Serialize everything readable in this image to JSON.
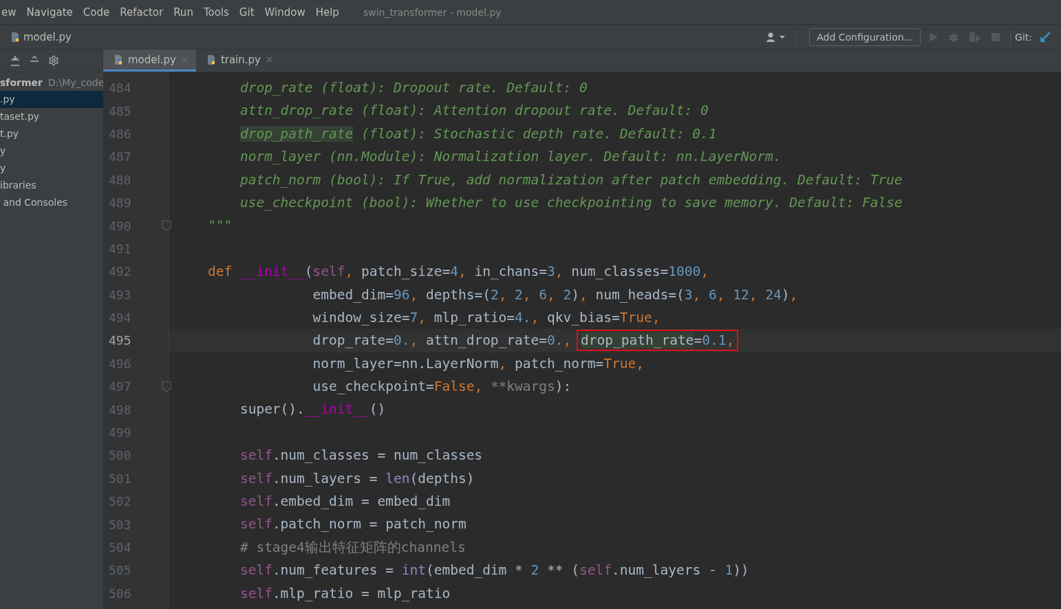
{
  "menu": {
    "items": [
      "ew",
      "Navigate",
      "Code",
      "Refactor",
      "Run",
      "Tools",
      "Git",
      "Window",
      "Help"
    ],
    "title": "swin_transformer - model.py"
  },
  "navbar": {
    "breadcrumb": "model.py",
    "config_button": "Add Configuration...",
    "git_label": "Git:"
  },
  "tabs": [
    {
      "label": "model.py",
      "selected": true
    },
    {
      "label": "train.py",
      "selected": false
    }
  ],
  "sidebar": {
    "header": {
      "name": "sformer",
      "path": "D:\\My_code"
    },
    "items": [
      {
        "label": ".py",
        "selected": true
      },
      {
        "label": "taset.py",
        "selected": false
      },
      {
        "label": "t.py",
        "selected": false
      },
      {
        "label": "y",
        "selected": false
      },
      {
        "label": "y",
        "selected": false
      },
      {
        "label": "ibraries",
        "selected": false
      },
      {
        "label": " and Consoles",
        "selected": false
      }
    ]
  },
  "editor": {
    "lines": [
      {
        "number": "484",
        "current": false,
        "fold": false,
        "kind": "body",
        "tokens": [
          {
            "kind": "doc",
            "text": "drop_rate (float): Dropout rate. Default: 0"
          }
        ]
      },
      {
        "number": "485",
        "current": false,
        "fold": false,
        "kind": "body",
        "tokens": [
          {
            "kind": "doc",
            "text": "attn_drop_rate (float): Attention dropout rate. Default: 0"
          }
        ]
      },
      {
        "number": "486",
        "current": false,
        "fold": false,
        "kind": "body",
        "tokens": [
          {
            "kind": "doc_match",
            "text": "drop_path_rate"
          },
          {
            "kind": "doc",
            "text": " (float): Stochastic depth rate. Default: 0.1"
          }
        ]
      },
      {
        "number": "487",
        "current": false,
        "fold": false,
        "kind": "body",
        "tokens": [
          {
            "kind": "doc",
            "text": "norm_layer (nn.Module): Normalization layer. Default: nn.LayerNorm."
          }
        ]
      },
      {
        "number": "488",
        "current": false,
        "fold": false,
        "kind": "body",
        "tokens": [
          {
            "kind": "doc",
            "text": "patch_norm (bool): If True, add normalization after patch embedding. Default: True"
          }
        ]
      },
      {
        "number": "489",
        "current": false,
        "fold": false,
        "kind": "body",
        "tokens": [
          {
            "kind": "doc",
            "text": "use_checkpoint (bool): Whether to use checkpointing to save memory. Default: False"
          }
        ]
      },
      {
        "number": "490",
        "current": false,
        "fold": true,
        "kind": "def",
        "tokens": [
          {
            "kind": "doc",
            "text": "\"\"\""
          }
        ]
      },
      {
        "number": "491",
        "current": false,
        "fold": false,
        "kind": "blank"
      },
      {
        "number": "492",
        "current": false,
        "fold": false,
        "kind": "def",
        "tokens": [
          {
            "kind": "kw",
            "text": "def "
          },
          {
            "kind": "dunder",
            "text": "__init__"
          },
          {
            "kind": "plain",
            "text": "("
          },
          {
            "kind": "self",
            "text": "self"
          },
          {
            "kind": "kw",
            "text": ", "
          },
          {
            "kind": "plain",
            "text": "patch_size="
          },
          {
            "kind": "num",
            "text": "4"
          },
          {
            "kind": "kw",
            "text": ", "
          },
          {
            "kind": "plain",
            "text": "in_chans="
          },
          {
            "kind": "num",
            "text": "3"
          },
          {
            "kind": "kw",
            "text": ", "
          },
          {
            "kind": "plain",
            "text": "num_classes="
          },
          {
            "kind": "num",
            "text": "1000"
          },
          {
            "kind": "kw",
            "text": ","
          }
        ]
      },
      {
        "number": "493",
        "current": false,
        "fold": false,
        "kind": "args",
        "tokens": [
          {
            "kind": "plain",
            "text": "embed_dim="
          },
          {
            "kind": "num",
            "text": "96"
          },
          {
            "kind": "kw",
            "text": ", "
          },
          {
            "kind": "plain",
            "text": "depths=("
          },
          {
            "kind": "num",
            "text": "2"
          },
          {
            "kind": "kw",
            "text": ", "
          },
          {
            "kind": "num",
            "text": "2"
          },
          {
            "kind": "kw",
            "text": ", "
          },
          {
            "kind": "num",
            "text": "6"
          },
          {
            "kind": "kw",
            "text": ", "
          },
          {
            "kind": "num",
            "text": "2"
          },
          {
            "kind": "plain",
            "text": ")"
          },
          {
            "kind": "kw",
            "text": ", "
          },
          {
            "kind": "plain",
            "text": "num_heads=("
          },
          {
            "kind": "num",
            "text": "3"
          },
          {
            "kind": "kw",
            "text": ", "
          },
          {
            "kind": "num",
            "text": "6"
          },
          {
            "kind": "kw",
            "text": ", "
          },
          {
            "kind": "num",
            "text": "12"
          },
          {
            "kind": "kw",
            "text": ", "
          },
          {
            "kind": "num",
            "text": "24"
          },
          {
            "kind": "plain",
            "text": ")"
          },
          {
            "kind": "kw",
            "text": ","
          }
        ]
      },
      {
        "number": "494",
        "current": false,
        "fold": false,
        "kind": "args",
        "tokens": [
          {
            "kind": "plain",
            "text": "window_size="
          },
          {
            "kind": "num",
            "text": "7"
          },
          {
            "kind": "kw",
            "text": ", "
          },
          {
            "kind": "plain",
            "text": "mlp_ratio="
          },
          {
            "kind": "num",
            "text": "4."
          },
          {
            "kind": "kw",
            "text": ", "
          },
          {
            "kind": "plain",
            "text": "qkv_bias="
          },
          {
            "kind": "kw",
            "text": "True"
          },
          {
            "kind": "kw",
            "text": ","
          }
        ]
      },
      {
        "number": "495",
        "current": true,
        "fold": false,
        "kind": "args",
        "tokens": [
          {
            "kind": "plain",
            "text": "drop_rate="
          },
          {
            "kind": "num",
            "text": "0."
          },
          {
            "kind": "kw",
            "text": ", "
          },
          {
            "kind": "plain",
            "text": "attn_drop_rate="
          },
          {
            "kind": "num",
            "text": "0."
          },
          {
            "kind": "kw",
            "text": ", "
          },
          {
            "kind": "box",
            "children": [
              {
                "kind": "match",
                "text": "drop_path_rate"
              },
              {
                "kind": "plain",
                "text": "="
              },
              {
                "kind": "num",
                "text": "0.1"
              },
              {
                "kind": "kw",
                "text": ","
              }
            ]
          }
        ]
      },
      {
        "number": "496",
        "current": false,
        "fold": false,
        "kind": "args",
        "tokens": [
          {
            "kind": "plain",
            "text": "norm_layer=nn.LayerNorm"
          },
          {
            "kind": "kw",
            "text": ", "
          },
          {
            "kind": "plain",
            "text": "patch_norm="
          },
          {
            "kind": "kw",
            "text": "True"
          },
          {
            "kind": "kw",
            "text": ","
          }
        ]
      },
      {
        "number": "497",
        "current": false,
        "fold": true,
        "kind": "args",
        "tokens": [
          {
            "kind": "plain",
            "text": "use_checkpoint="
          },
          {
            "kind": "kw",
            "text": "False"
          },
          {
            "kind": "kw",
            "text": ", "
          },
          {
            "kind": "muted",
            "text": "**kwargs"
          },
          {
            "kind": "plain",
            "text": "):"
          }
        ]
      },
      {
        "number": "498",
        "current": false,
        "fold": false,
        "kind": "body",
        "tokens": [
          {
            "kind": "plain",
            "text": "super()."
          },
          {
            "kind": "dunder",
            "text": "__init__"
          },
          {
            "kind": "plain",
            "text": "()"
          }
        ]
      },
      {
        "number": "499",
        "current": false,
        "fold": false,
        "kind": "blank"
      },
      {
        "number": "500",
        "current": false,
        "fold": false,
        "kind": "body",
        "tokens": [
          {
            "kind": "self",
            "text": "self"
          },
          {
            "kind": "plain",
            "text": ".num_classes = num_classes"
          }
        ]
      },
      {
        "number": "501",
        "current": false,
        "fold": false,
        "kind": "body",
        "tokens": [
          {
            "kind": "self",
            "text": "self"
          },
          {
            "kind": "plain",
            "text": ".num_layers = "
          },
          {
            "kind": "builtin",
            "text": "len"
          },
          {
            "kind": "plain",
            "text": "(depths)"
          }
        ]
      },
      {
        "number": "502",
        "current": false,
        "fold": false,
        "kind": "body",
        "tokens": [
          {
            "kind": "self",
            "text": "self"
          },
          {
            "kind": "plain",
            "text": ".embed_dim = embed_dim"
          }
        ]
      },
      {
        "number": "503",
        "current": false,
        "fold": false,
        "kind": "body",
        "tokens": [
          {
            "kind": "self",
            "text": "self"
          },
          {
            "kind": "plain",
            "text": ".patch_norm = patch_norm"
          }
        ]
      },
      {
        "number": "504",
        "current": false,
        "fold": false,
        "kind": "body",
        "tokens": [
          {
            "kind": "comment",
            "text": "# stage4输出特征矩阵的channels"
          }
        ]
      },
      {
        "number": "505",
        "current": false,
        "fold": false,
        "kind": "body",
        "tokens": [
          {
            "kind": "self",
            "text": "self"
          },
          {
            "kind": "plain",
            "text": ".num_features = "
          },
          {
            "kind": "builtin",
            "text": "int"
          },
          {
            "kind": "plain",
            "text": "(embed_dim * "
          },
          {
            "kind": "num",
            "text": "2"
          },
          {
            "kind": "plain",
            "text": " ** ("
          },
          {
            "kind": "self",
            "text": "self"
          },
          {
            "kind": "plain",
            "text": ".num_layers - "
          },
          {
            "kind": "num",
            "text": "1"
          },
          {
            "kind": "plain",
            "text": "))"
          }
        ]
      },
      {
        "number": "506",
        "current": false,
        "fold": false,
        "kind": "body",
        "tokens": [
          {
            "kind": "self",
            "text": "self"
          },
          {
            "kind": "plain",
            "text": ".mlp_ratio = mlp_ratio"
          }
        ]
      }
    ]
  }
}
